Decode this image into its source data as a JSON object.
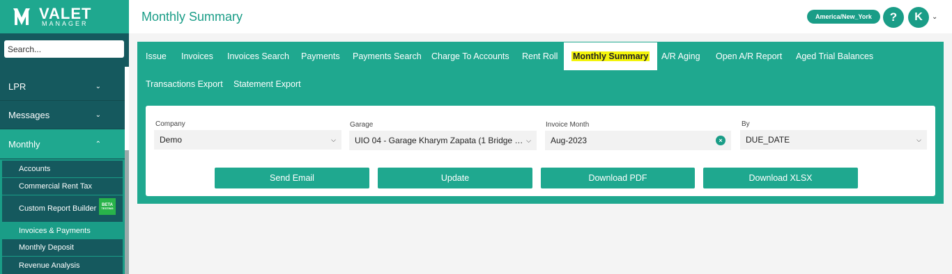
{
  "brand": {
    "line1": "VALET",
    "line2": "MANAGER"
  },
  "sidebar": {
    "search_placeholder": "Search...",
    "items": [
      {
        "label": "LPR",
        "chevron": "˅"
      },
      {
        "label": "Messages",
        "chevron": "˅"
      },
      {
        "label": "Monthly",
        "chevron": "˄"
      }
    ],
    "sub_items": [
      {
        "label": "Accounts"
      },
      {
        "label": "Commercial Rent Tax"
      },
      {
        "label": "Custom Report Builder"
      },
      {
        "label": "Invoices & Payments"
      },
      {
        "label": "Monthly Deposit"
      },
      {
        "label": "Revenue Analysis"
      }
    ],
    "beta_badge": {
      "line1": "BETA",
      "line2": "TESTING"
    }
  },
  "header": {
    "title": "Monthly Summary",
    "timezone": "America/New_York",
    "help_label": "?",
    "avatar_initial": "K"
  },
  "tabs": [
    {
      "label": "Issue"
    },
    {
      "label": "Invoices"
    },
    {
      "label": "Invoices Search"
    },
    {
      "label": "Payments"
    },
    {
      "label": "Payments Search"
    },
    {
      "label": "Charge To Accounts"
    },
    {
      "label": "Rent Roll"
    },
    {
      "label": "Monthly Summary"
    },
    {
      "label": "A/R Aging"
    },
    {
      "label": "Open A/R Report"
    },
    {
      "label": "Aged Trial Balances"
    },
    {
      "label": "Transactions Export"
    },
    {
      "label": "Statement Export"
    }
  ],
  "filters": {
    "company": {
      "label": "Company",
      "value": "Demo"
    },
    "garage": {
      "label": "Garage",
      "value": "UIO 04 - Garage Kharym Zapata (1 Bridge …"
    },
    "invoice_month": {
      "label": "Invoice Month",
      "value": "Aug-2023"
    },
    "by": {
      "label": "By",
      "value": "DUE_DATE"
    }
  },
  "actions": {
    "send_email": "Send Email",
    "update": "Update",
    "download_pdf": "Download PDF",
    "download_xlsx": "Download XLSX"
  },
  "colors": {
    "primary": "#1fa88f",
    "dark": "#15595e",
    "highlight": "#f4f40a"
  }
}
